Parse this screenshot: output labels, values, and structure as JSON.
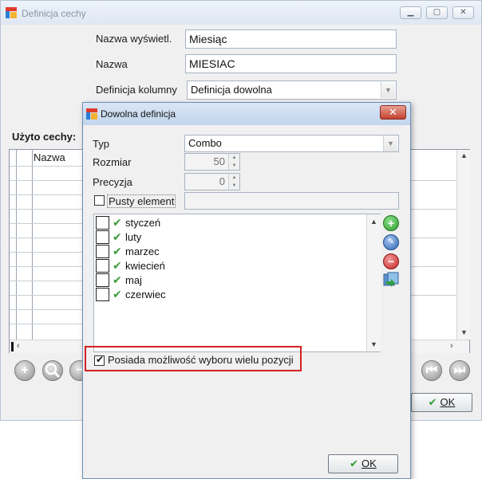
{
  "main": {
    "title": "Definicja cechy",
    "labels": {
      "display_name": "Nazwa wyświetl.",
      "name": "Nazwa",
      "column_def": "Definicja kolumny",
      "used": "Użyto cechy:"
    },
    "values": {
      "display_name": "Miesiąc",
      "name": "MIESIAC",
      "column_def": "Definicja dowolna"
    },
    "grid_header": "Nazwa",
    "ok_label": "OK"
  },
  "dialog": {
    "title": "Dowolna definicja",
    "close_label": "✕",
    "labels": {
      "type": "Typ",
      "size": "Rozmiar",
      "precision": "Precyzja",
      "empty": "Pusty element"
    },
    "values": {
      "type": "Combo",
      "size": "50",
      "precision": "0"
    },
    "items": [
      "styczeń",
      "luty",
      "marzec",
      "kwiecień",
      "maj",
      "czerwiec"
    ],
    "multi_select_label": "Posiada możliwość wyboru wielu pozycji",
    "ok_label": "OK"
  },
  "colors": {
    "highlight": "#d42020",
    "check": "#3c9b3c"
  }
}
